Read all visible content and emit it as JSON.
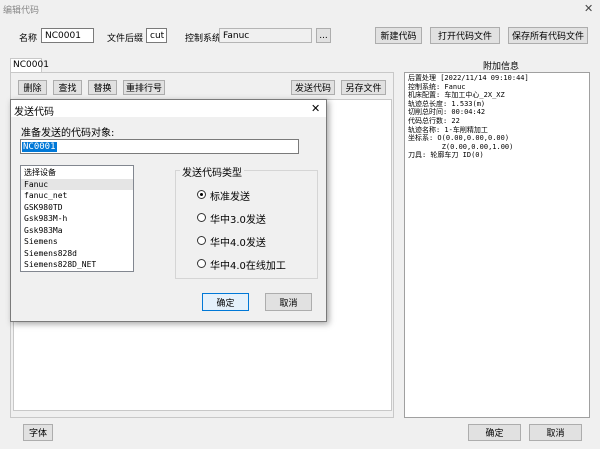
{
  "window": {
    "title": "编辑代码"
  },
  "top": {
    "name_label": "名称",
    "name_value": "NC0001",
    "ext_label": "文件后缀",
    "ext_value": "cut",
    "system_label": "控制系统",
    "system_value": "Fanuc",
    "browse_label": "...",
    "new_button": "新建代码",
    "open_button": "打开代码文件",
    "save_all_button": "保存所有代码文件"
  },
  "tab": {
    "label": "NC0001"
  },
  "toolbar": {
    "delete": "删除",
    "find": "查找",
    "replace": "替换",
    "renumber": "重排行号",
    "send": "发送代码",
    "save_as": "另存文件"
  },
  "extra": {
    "title": "附加信息",
    "lines": [
      "后置处理 [2022/11/14 09:10:44]",
      "控制系统: Fanuc",
      "机床配置: 车加工中心_2X_XZ",
      "轨迹总长度: 1.533(m)",
      "切削总时间: 00:04:42",
      "代码总行数: 22",
      "轨迹名称: 1-车削精加工",
      "坐标系: O(0.00,0.00,0.00)",
      "        Z(0.00,0.00,1.00)",
      "刀具: 轮廓车刀 ID(0)"
    ]
  },
  "bottom": {
    "font_button": "字体",
    "ok_button": "确定",
    "cancel_button": "取消"
  },
  "dialog": {
    "title": "发送代码",
    "close": "✕",
    "prompt": "准备发送的代码对象:",
    "target_value": "NC0001",
    "devices": [
      "选择设备",
      "Fanuc",
      "fanuc_net",
      "GSK980TD",
      "Gsk983M-h",
      "Gsk983Ma",
      "Siemens",
      "Siemens828d",
      "Siemens828D_NET"
    ],
    "selected_device": "Fanuc",
    "send_type_title": "发送代码类型",
    "options": [
      "标准发送",
      "华中3.0发送",
      "华中4.0发送",
      "华中4.0在线加工"
    ],
    "selected_option": "标准发送",
    "ok": "确定",
    "cancel": "取消"
  }
}
